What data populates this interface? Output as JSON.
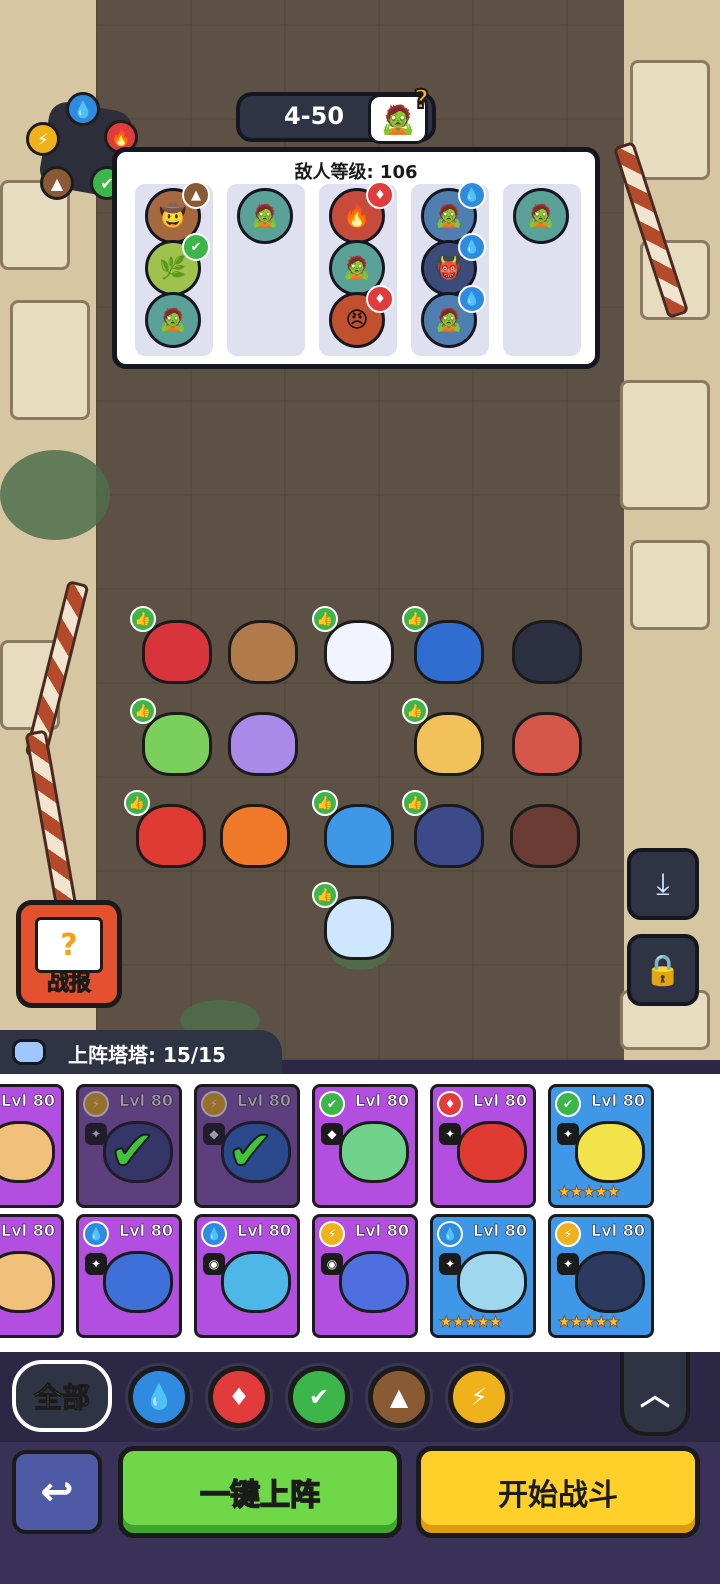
{
  "header": {
    "stage": "4-50"
  },
  "enemy_panel": {
    "title": "敌人等级: 106"
  },
  "side": {
    "report_label": "战报"
  },
  "deploy": {
    "label": "上阵塔塔: 15/15"
  },
  "roster_cards": [
    {
      "lvl": "Lvl 80"
    },
    {
      "lvl": "Lvl 80"
    },
    {
      "lvl": "Lvl 80"
    },
    {
      "lvl": "Lvl 80"
    },
    {
      "lvl": "Lvl 80"
    },
    {
      "lvl": "Lvl 80"
    },
    {
      "lvl": "Lvl 80"
    },
    {
      "lvl": "Lvl 80"
    },
    {
      "lvl": "Lvl 80"
    },
    {
      "lvl": "Lvl 80"
    },
    {
      "lvl": "Lvl 80"
    },
    {
      "lvl": "Lvl 80"
    }
  ],
  "filter": {
    "all_label": "全部"
  },
  "actions": {
    "auto_deploy": "一键上阵",
    "start_battle": "开始战斗"
  },
  "colors": {
    "water": "#2f8be0",
    "fire": "#e23b3b",
    "grass": "#3cb64a",
    "earth": "#8a5a34",
    "thunder": "#f0b21a",
    "card_purple": "#b24fe0",
    "card_blue": "#3f97e8"
  }
}
